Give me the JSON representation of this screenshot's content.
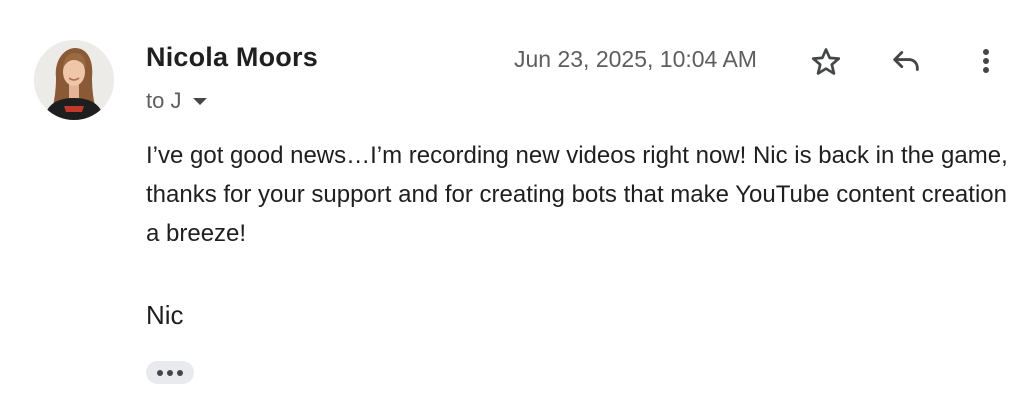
{
  "message": {
    "sender_name": "Nicola Moors",
    "recipient_label": "to J",
    "timestamp": "Jun 23, 2025, 10:04 AM",
    "body": "I’ve got good news…I’m recording new videos right now! Nic is back in the game, thanks for your support and for creating bots that make YouTube content creation a breeze!",
    "signature": "Nic"
  },
  "icons": {
    "avatar": "avatar-photo",
    "star": "star-outline-icon",
    "reply": "reply-icon",
    "more": "more-vert-icon",
    "expand": "more-horiz-icon",
    "recipient_dropdown": "arrow-drop-down-icon"
  },
  "colors": {
    "text_primary": "#1f1f1f",
    "text_secondary": "#5e5e5e",
    "icon": "#444746",
    "chip_background": "#e8eaed"
  }
}
